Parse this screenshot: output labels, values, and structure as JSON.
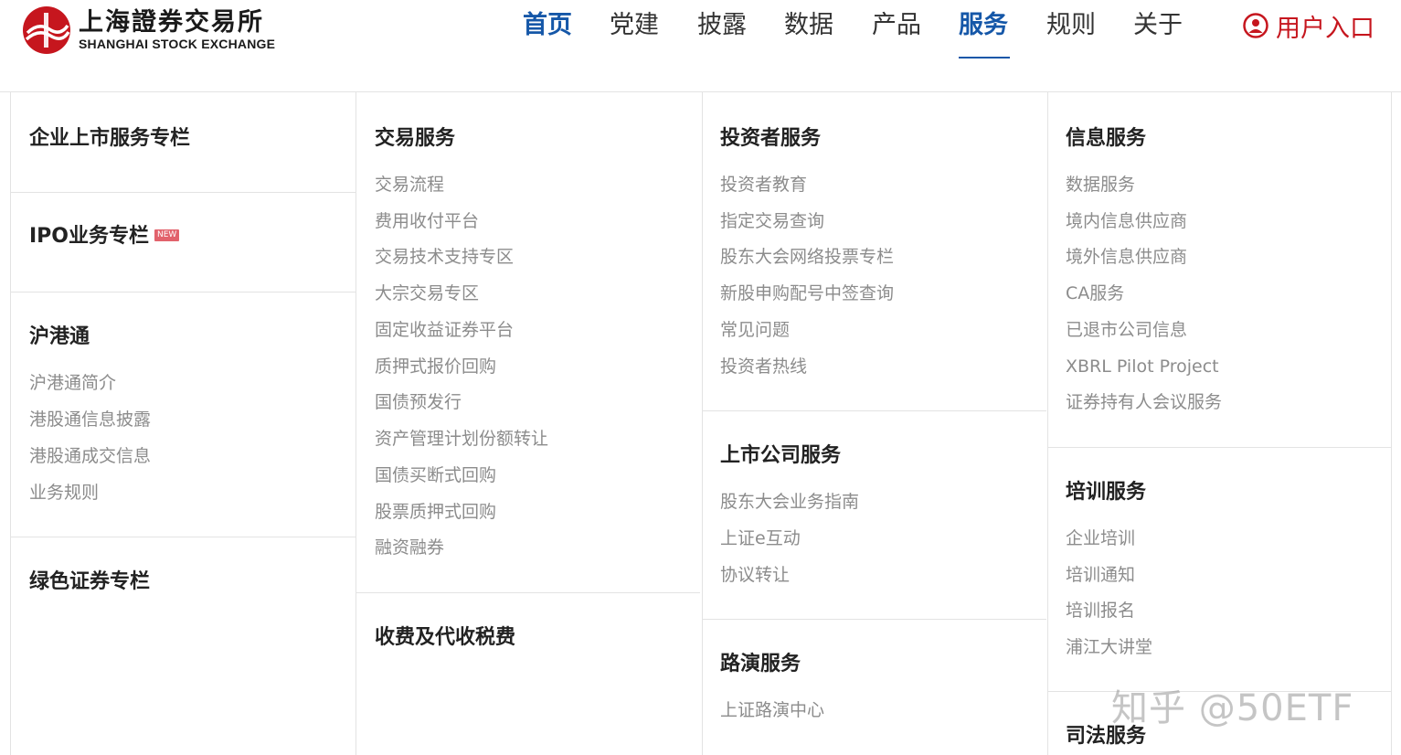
{
  "brand": {
    "name_cn": "上海證券交易所",
    "name_en": "SHANGHAI STOCK EXCHANGE",
    "color": "#c6161e"
  },
  "nav": {
    "items": [
      {
        "label": "首页",
        "highlight": true
      },
      {
        "label": "党建"
      },
      {
        "label": "披露"
      },
      {
        "label": "数据"
      },
      {
        "label": "产品"
      },
      {
        "label": "服务",
        "highlight": true,
        "active": true
      },
      {
        "label": "规则"
      },
      {
        "label": "关于"
      }
    ],
    "user_entry": {
      "label": "用户入口",
      "icon": "user-circle-icon"
    },
    "accent": "#1557a8"
  },
  "columns": {
    "col1": {
      "listing": {
        "title": "企业上市服务专栏"
      },
      "ipo": {
        "title": "IPO业务专栏",
        "badge": "NEW"
      },
      "hkconnect": {
        "title": "沪港通",
        "links": [
          "沪港通简介",
          "港股通信息披露",
          "港股通成交信息",
          "业务规则"
        ]
      },
      "green": {
        "title": "绿色证券专栏"
      }
    },
    "col2": {
      "trading": {
        "title": "交易服务",
        "links": [
          "交易流程",
          "费用收付平台",
          "交易技术支持专区",
          "大宗交易专区",
          "固定收益证券平台",
          "质押式报价回购",
          "国债预发行",
          "资产管理计划份额转让",
          "国债买断式回购",
          "股票质押式回购",
          "融资融券"
        ]
      },
      "fees": {
        "title": "收费及代收税费"
      }
    },
    "col3": {
      "investor": {
        "title": "投资者服务",
        "links": [
          "投资者教育",
          "指定交易查询",
          "股东大会网络投票专栏",
          "新股申购配号中签查询",
          "常见问题",
          "投资者热线"
        ]
      },
      "listed": {
        "title": "上市公司服务",
        "links": [
          "股东大会业务指南",
          "上证e互动",
          "协议转让"
        ]
      },
      "roadshow": {
        "title": "路演服务",
        "links": [
          "上证路演中心"
        ]
      }
    },
    "col4": {
      "info": {
        "title": "信息服务",
        "links": [
          "数据服务",
          "境内信息供应商",
          "境外信息供应商",
          "CA服务",
          "已退市公司信息",
          "XBRL Pilot Project",
          "证券持有人会议服务"
        ]
      },
      "training": {
        "title": "培训服务",
        "links": [
          "企业培训",
          "培训通知",
          "培训报名",
          "浦江大讲堂"
        ]
      },
      "judicial": {
        "title": "司法服务"
      }
    }
  },
  "watermark": "知乎 @50ETF"
}
